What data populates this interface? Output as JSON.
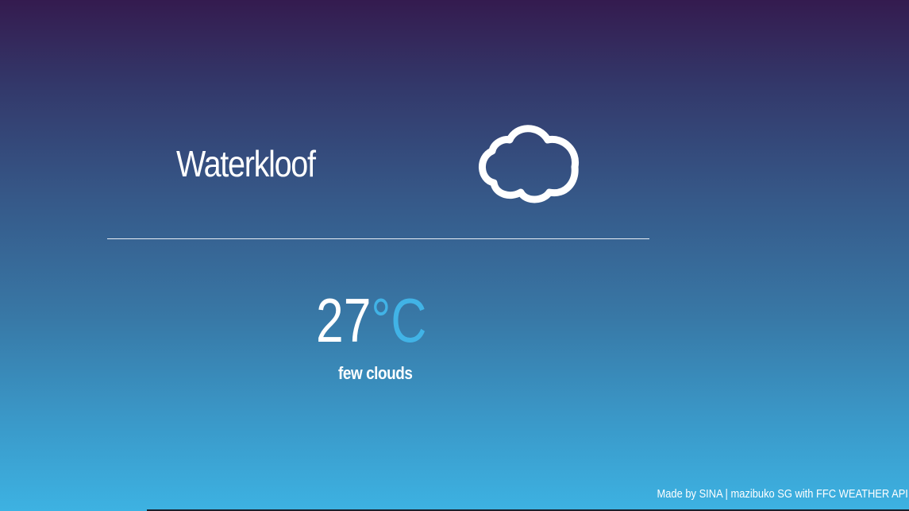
{
  "location": {
    "city": "Waterkloof"
  },
  "weather": {
    "icon": "cloud-icon",
    "temperature": "27",
    "unit": "°C",
    "description": "few clouds"
  },
  "footer": {
    "credit": "Made by SINA | mazibuko SG with FFC WEATHER API"
  },
  "colors": {
    "gradient_top": "#341b4f",
    "gradient_bottom": "#3db2e2",
    "unit_accent": "#41b3e6",
    "text": "#ffffff"
  }
}
